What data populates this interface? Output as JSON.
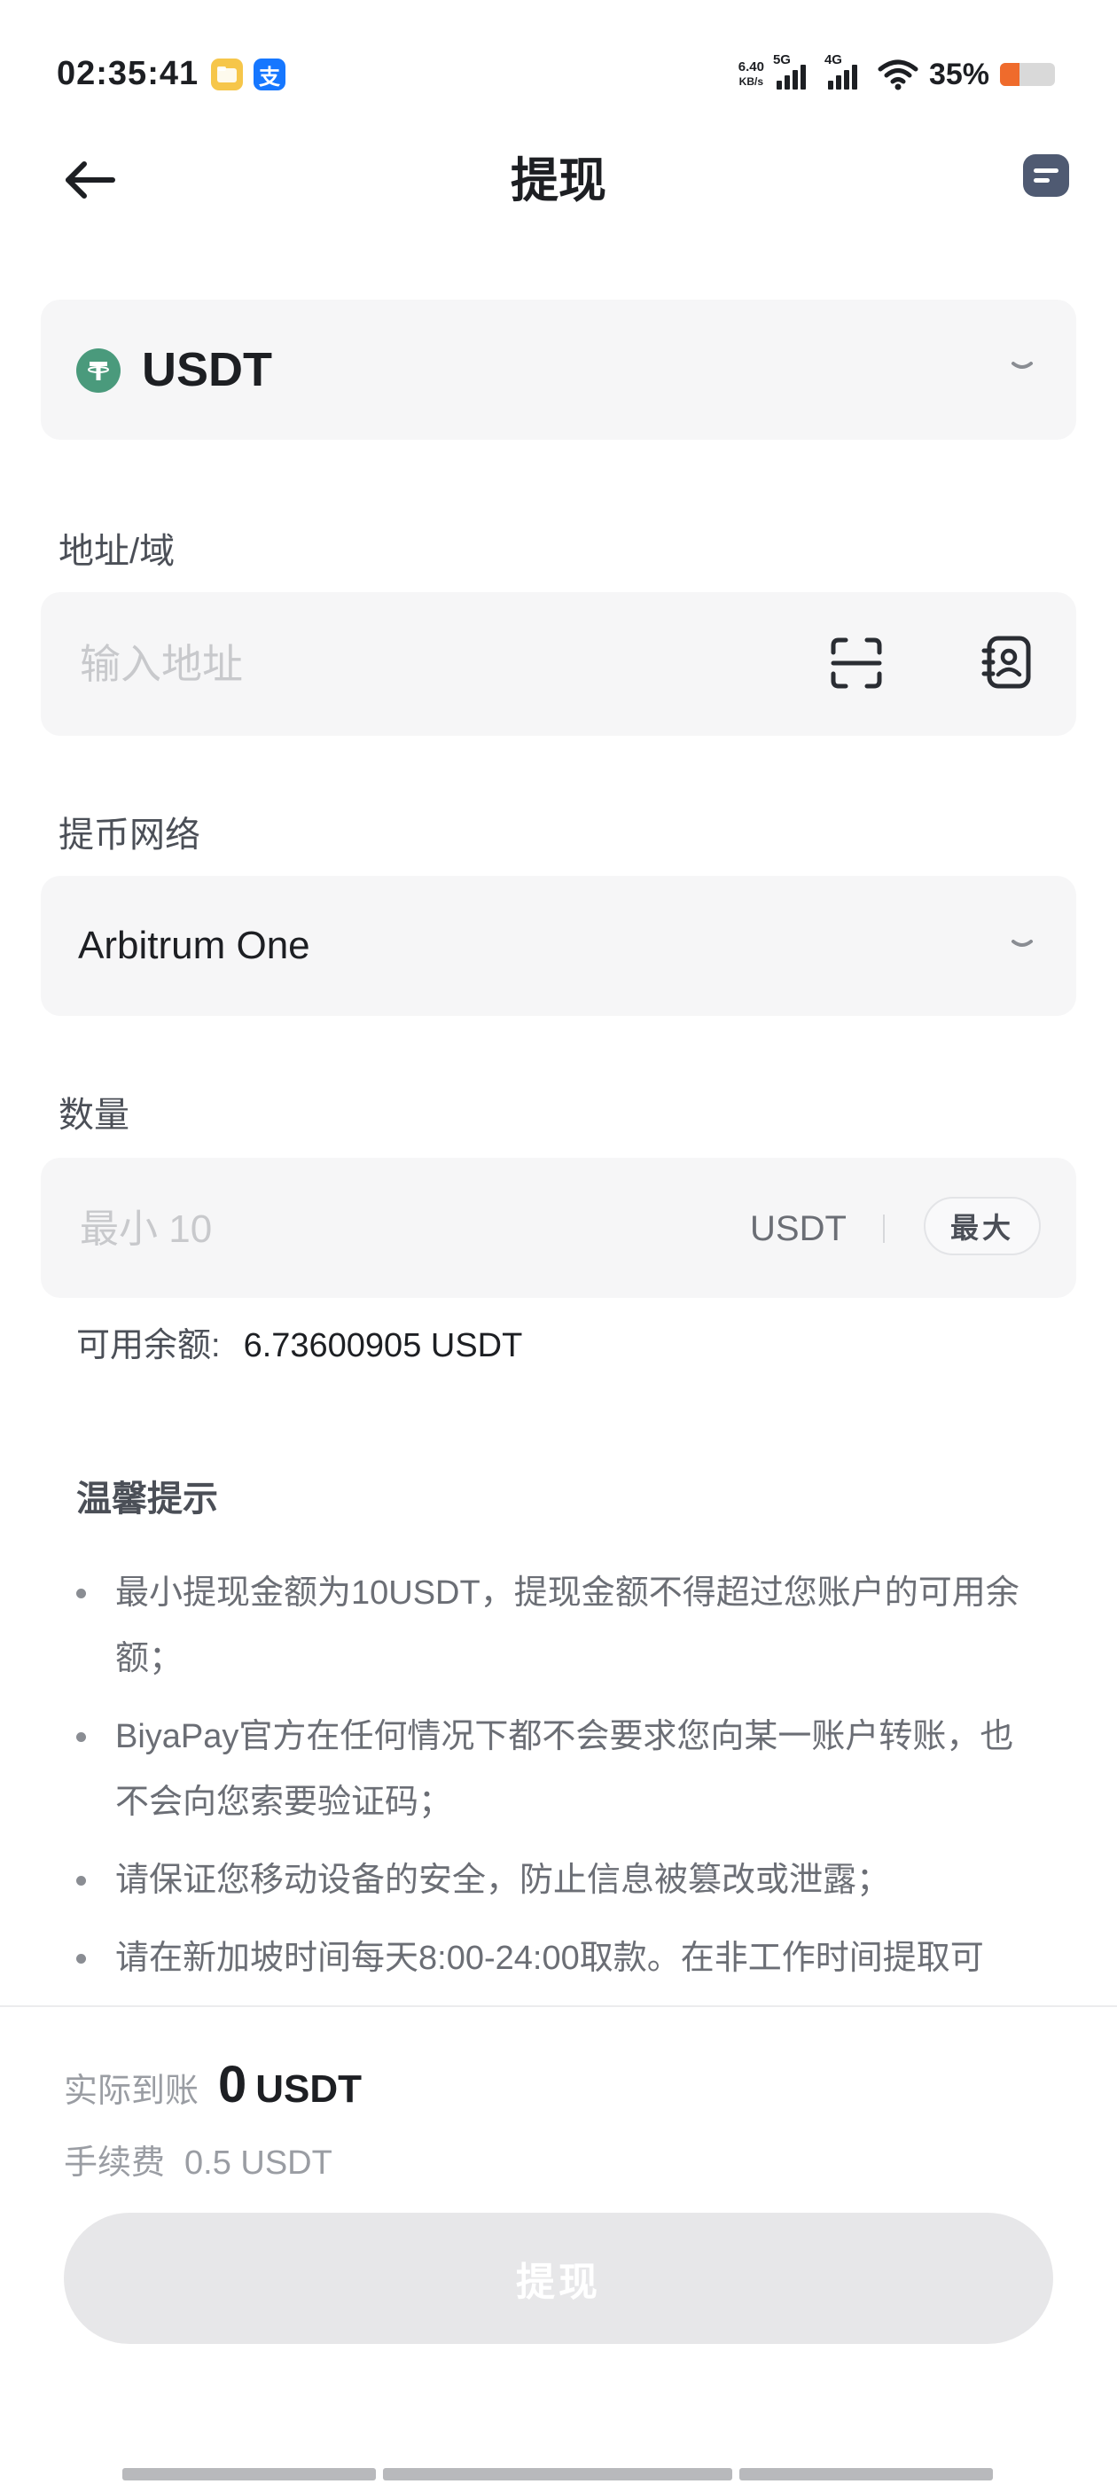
{
  "status_bar": {
    "time": "02:35:41",
    "files_icon": "files-app-icon",
    "alipay_glyph": "支",
    "net_speed_value": "6.40",
    "net_speed_unit": "KB/s",
    "signal_1_label": "5G",
    "signal_2_label": "4G",
    "battery_percent": "35%",
    "battery_level": 0.35,
    "battery_color": "#ef6b2c"
  },
  "header": {
    "title": "提现",
    "back_icon": "arrow-left-icon",
    "record_icon": "record-list-icon"
  },
  "coin": {
    "name": "USDT",
    "logo_glyph": "T",
    "logo_color": "#4a9a7c"
  },
  "address": {
    "label": "地址/域",
    "placeholder": "输入地址",
    "value": ""
  },
  "network": {
    "label": "提币网络",
    "value": "Arbitrum One"
  },
  "amount": {
    "label": "数量",
    "placeholder": "最小 10",
    "value": "",
    "unit": "USDT",
    "max_label": "最大",
    "available_label": "可用余额:",
    "available_value": "6.73600905 USDT"
  },
  "tips": {
    "title": "温馨提示",
    "items": [
      "最小提现金额为10USDT，提现金额不得超过您账户的可用余额；",
      "BiyaPay官方在任何情况下都不会要求您向某一账户转账，也不会向您索要验证码；",
      "请保证您移动设备的安全，防止信息被篡改或泄露；",
      "请在新加坡时间每天8:00-24:00取款。在非工作时间提取可"
    ]
  },
  "footer": {
    "receive_label": "实际到账",
    "receive_amount": "0",
    "receive_unit": "USDT",
    "fee_label": "手续费",
    "fee_value": "0.5 USDT",
    "submit_label": "提现"
  },
  "colors": {
    "accent_text": "#1d1f23",
    "card_bg": "#f6f6f7",
    "disabled_button": "#e7e7e9"
  }
}
